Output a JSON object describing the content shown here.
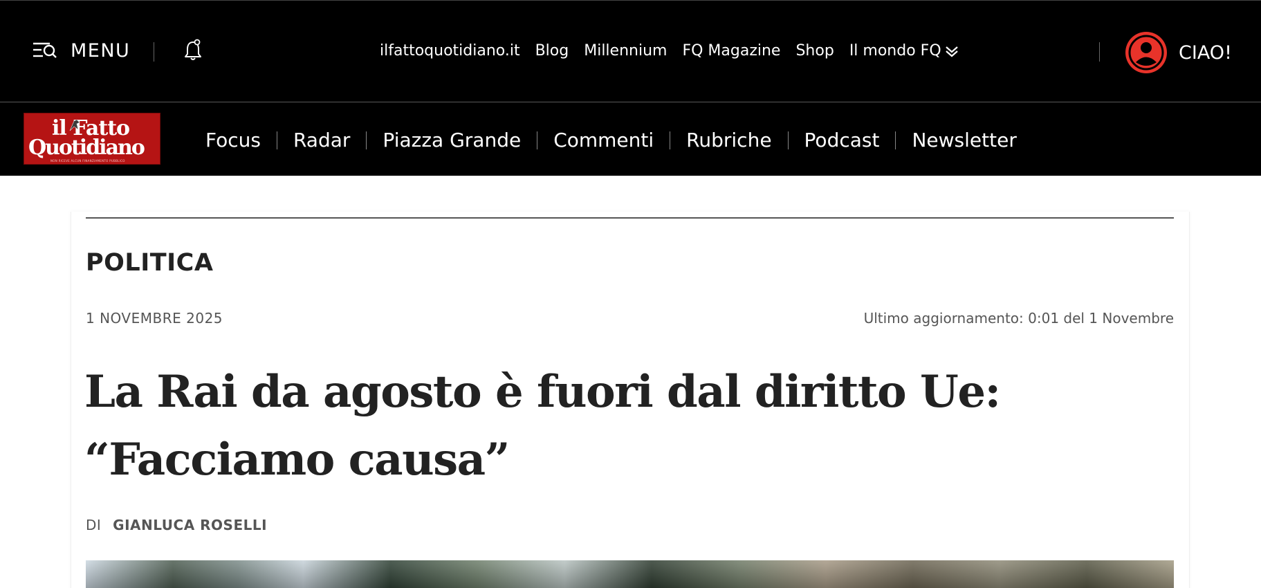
{
  "topbar": {
    "menu_label": "MENU",
    "links": [
      "ilfattoquotidiano.it",
      "Blog",
      "Millennium",
      "FQ Magazine",
      "Shop"
    ],
    "mondo_label": "Il mondo FQ",
    "user_label": "CIAO!"
  },
  "logo": {
    "line1": "il Fatto",
    "line2": "Quotidiano",
    "tagline": "NON RICEVE ALCUN FINANZIAMENTO PUBBLICO"
  },
  "nav": {
    "items": [
      "Focus",
      "Radar",
      "Piazza Grande",
      "Commenti",
      "Rubriche",
      "Podcast",
      "Newsletter"
    ]
  },
  "article": {
    "section": "POLITICA",
    "date": "1 NOVEMBRE 2025",
    "updated": "Ultimo aggiornamento: 0:01 del 1 Novembre",
    "headline": "La Rai da agosto è fuori dal diritto Ue: “Facciamo causa”",
    "byline_prefix": "DI",
    "author": "GIANLUCA ROSELLI"
  },
  "colors": {
    "brand_red": "#b51414",
    "avatar_red": "#e8332a",
    "topbar_bg": "#000000"
  },
  "icons": {
    "menu": "menu-search-icon",
    "notifications": "bell-icon",
    "dropdown": "double-chevron-down-icon",
    "user": "user-avatar-icon"
  }
}
